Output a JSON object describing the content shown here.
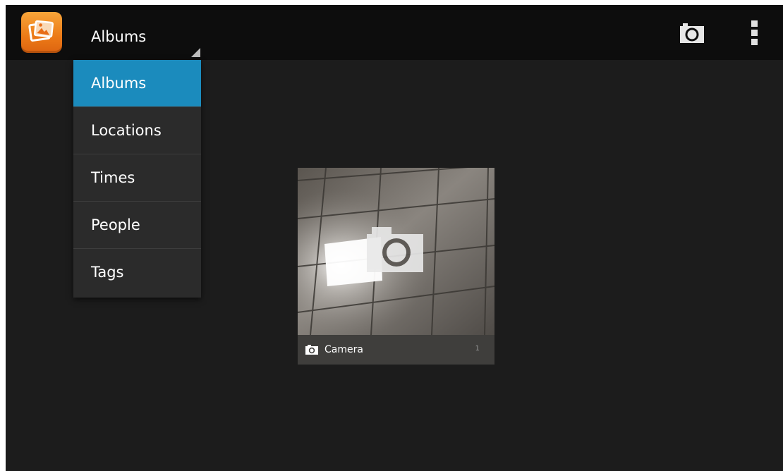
{
  "actionbar": {
    "app_icon": "gallery-app-icon",
    "spinner_label": "Albums",
    "actions": {
      "camera_icon": "camera-icon",
      "overflow_icon": "overflow-menu-icon"
    }
  },
  "menu": {
    "items": [
      {
        "label": "Albums",
        "selected": true
      },
      {
        "label": "Locations",
        "selected": false
      },
      {
        "label": "Times",
        "selected": false
      },
      {
        "label": "People",
        "selected": false
      },
      {
        "label": "Tags",
        "selected": false
      }
    ]
  },
  "albums": [
    {
      "name": "Camera",
      "count": "1",
      "icon": "camera-icon"
    }
  ],
  "colors": {
    "accent": "#1b8bbd",
    "background": "#1c1c1c",
    "actionbar": "#0d0d0d",
    "app_icon": "#ec7a17"
  }
}
